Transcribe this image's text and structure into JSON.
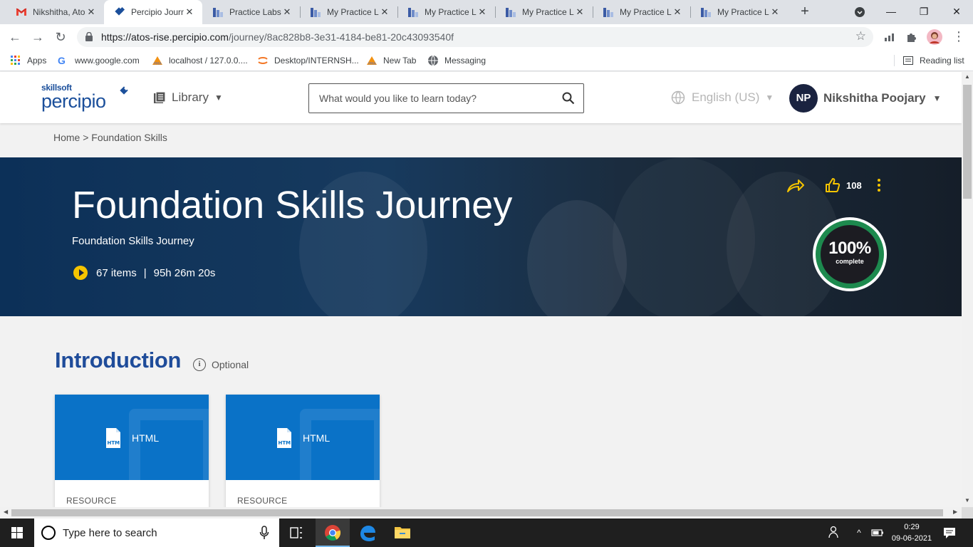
{
  "browser": {
    "tabs": [
      {
        "title": "Nikshitha, Atos",
        "icon": "gmail-icon",
        "active": false
      },
      {
        "title": "Percipio Journey",
        "icon": "percipio-icon",
        "active": true
      },
      {
        "title": "Practice Labs",
        "icon": "practice-labs-icon",
        "active": false
      },
      {
        "title": "My Practice Labs",
        "icon": "practice-labs-icon",
        "active": false
      },
      {
        "title": "My Practice Labs",
        "icon": "practice-labs-icon",
        "active": false
      },
      {
        "title": "My Practice Labs",
        "icon": "practice-labs-icon",
        "active": false
      },
      {
        "title": "My Practice Labs",
        "icon": "practice-labs-icon",
        "active": false
      },
      {
        "title": "My Practice Labs",
        "icon": "practice-labs-icon",
        "active": false
      }
    ],
    "url_host": "https://atos-rise.percipio.com",
    "url_path": "/journey/8ac828b8-3e31-4184-be81-20c43093540f",
    "bookmarks": [
      {
        "label": "Apps",
        "icon": "apps-grid-icon"
      },
      {
        "label": "www.google.com",
        "icon": "google-icon"
      },
      {
        "label": "localhost / 127.0.0....",
        "icon": "phpmyadmin-icon"
      },
      {
        "label": "Desktop/INTERNSH...",
        "icon": "jupyter-icon"
      },
      {
        "label": "New Tab",
        "icon": "phpmyadmin-icon"
      },
      {
        "label": "Messaging",
        "icon": "globe-icon"
      }
    ],
    "reading_list": "Reading list"
  },
  "header": {
    "logo_small": "skillsoft",
    "logo_big": "percipio",
    "library_label": "Library",
    "search_placeholder": "What would you like to learn today?",
    "language": "English (US)",
    "user_initials": "NP",
    "user_name": "Nikshitha Poojary"
  },
  "breadcrumb": "Home > Foundation Skills",
  "hero": {
    "title": "Foundation Skills Journey",
    "subtitle": "Foundation Skills Journey",
    "items": "67 items",
    "separator": "|",
    "duration": "95h 26m 20s",
    "likes": "108",
    "progress_pct": "100%",
    "progress_label": "complete",
    "progress_value": 1.0,
    "accent_color": "#f5c400",
    "progress_color": "#1d8a4e"
  },
  "section": {
    "title": "Introduction",
    "optional_label": "Optional",
    "title_color": "#1f4c9a"
  },
  "cards": [
    {
      "file_type": "HTML",
      "content_type": "RESOURCE"
    },
    {
      "file_type": "HTML",
      "content_type": "RESOURCE"
    }
  ],
  "taskbar": {
    "search_placeholder": "Type here to search",
    "time": "0:29",
    "date": "09-06-2021"
  }
}
